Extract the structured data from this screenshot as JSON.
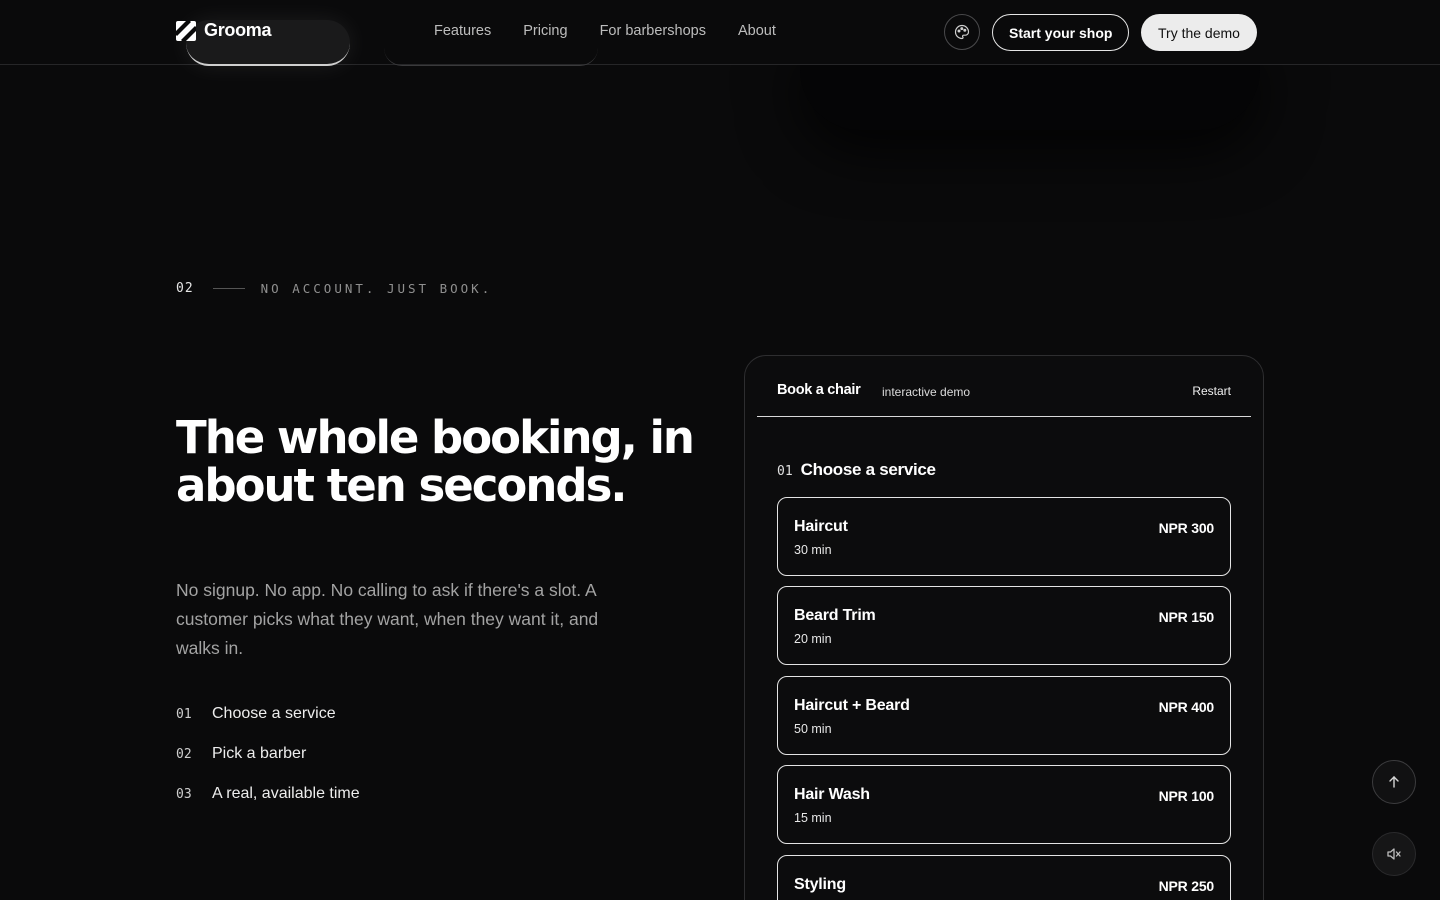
{
  "nav": {
    "brand": "Grooma",
    "links": [
      "Features",
      "Pricing",
      "For barbershops",
      "About"
    ],
    "start_shop": "Start your shop",
    "try_demo": "Try the demo"
  },
  "section": {
    "number": "02",
    "eyebrow": "NO ACCOUNT. JUST BOOK.",
    "headline": "The whole booking, in about ten seconds.",
    "lede": "No signup. No app. No calling to ask if there's a slot. A customer picks what they want, when they want it, and walks in.",
    "steps": [
      {
        "num": "01",
        "label": "Choose a service"
      },
      {
        "num": "02",
        "label": "Pick a barber"
      },
      {
        "num": "03",
        "label": "A real, available time"
      }
    ]
  },
  "demo": {
    "title": "Book a chair",
    "subtitle": "interactive demo",
    "restart": "Restart",
    "step_num": "01",
    "step_title": "Choose a service",
    "services": [
      {
        "name": "Haircut",
        "duration": "30 min",
        "price": "NPR 300"
      },
      {
        "name": "Beard Trim",
        "duration": "20 min",
        "price": "NPR 150"
      },
      {
        "name": "Haircut + Beard",
        "duration": "50 min",
        "price": "NPR 400"
      },
      {
        "name": "Hair Wash",
        "duration": "15 min",
        "price": "NPR 100"
      },
      {
        "name": "Styling",
        "duration": "",
        "price": "NPR 250"
      }
    ]
  },
  "icons": {
    "theme": "palette-icon",
    "scroll_top": "arrow-up-icon",
    "sound": "volume-mute-icon"
  }
}
